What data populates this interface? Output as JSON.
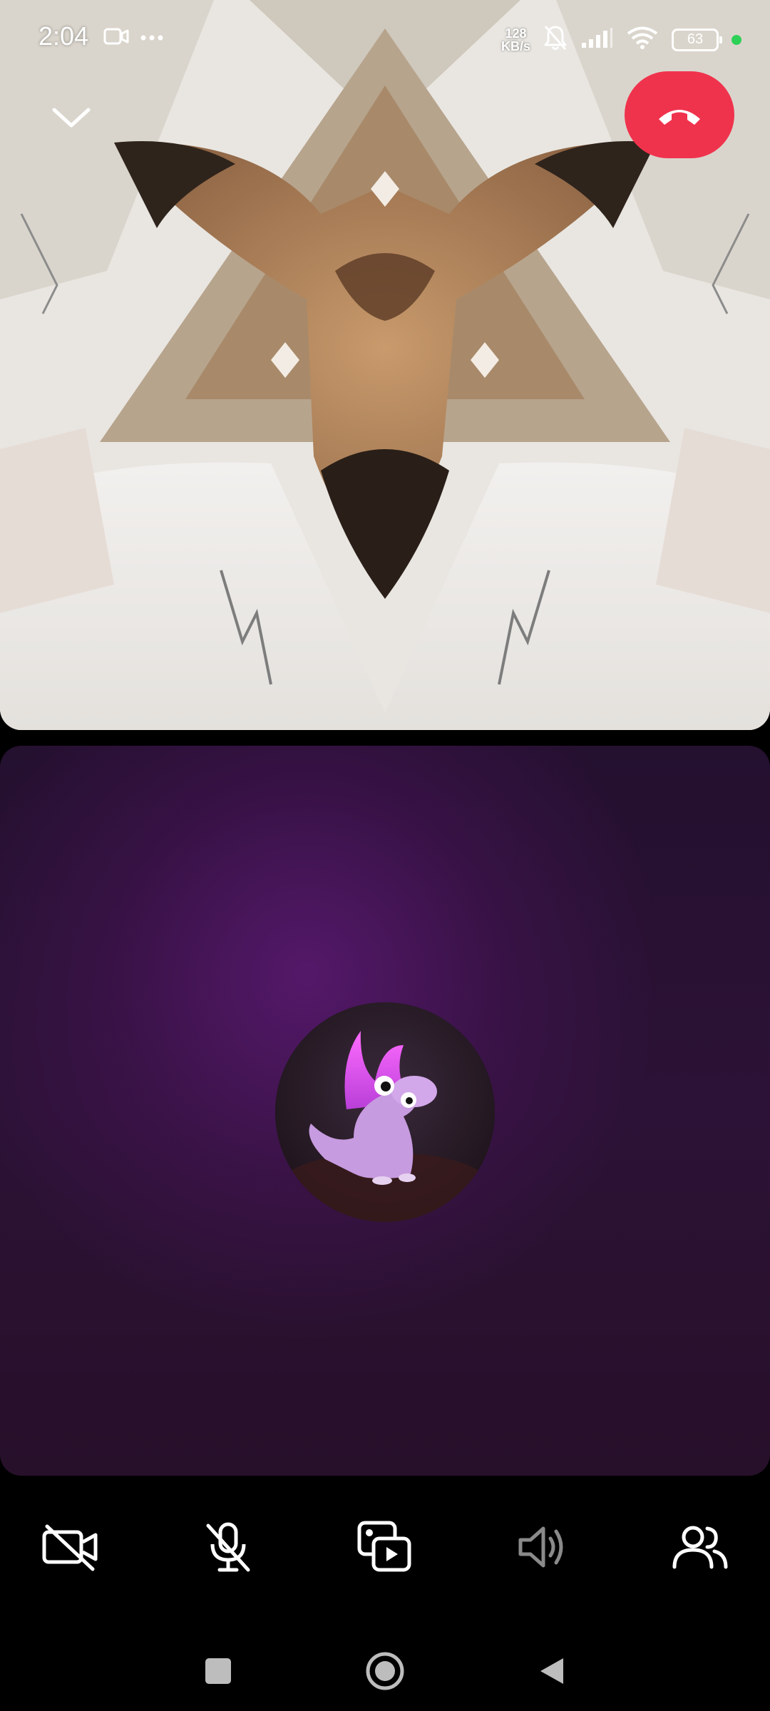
{
  "status_bar": {
    "time": "2:04",
    "net_speed_value": "128",
    "net_speed_unit": "KB/s",
    "battery": "63",
    "icons": [
      "video-record-icon",
      "more-dots-icon",
      "bell-off-icon",
      "signal-icon",
      "wifi-icon",
      "battery-icon",
      "privacy-dot"
    ]
  },
  "call": {
    "end_call_color": "#f0334d",
    "collapse_icon": "chevron-down-icon"
  },
  "controls": [
    {
      "name": "camera-off-button",
      "icon": "video-off-icon"
    },
    {
      "name": "mute-button",
      "icon": "mic-off-icon"
    },
    {
      "name": "share-media-button",
      "icon": "media-play-icon"
    },
    {
      "name": "speaker-button",
      "icon": "speaker-icon"
    },
    {
      "name": "participants-button",
      "icon": "people-icon"
    }
  ],
  "navigation": [
    "recent-apps-icon",
    "home-icon",
    "back-icon"
  ]
}
